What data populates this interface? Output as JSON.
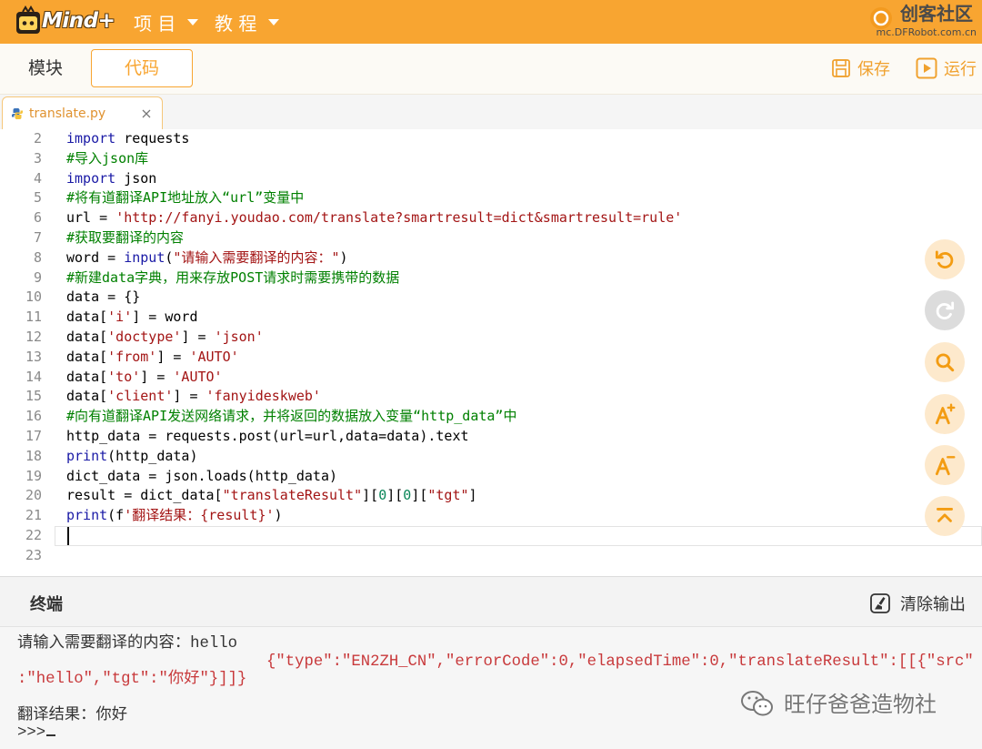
{
  "app": {
    "logo_text": "Mind+",
    "menu": [
      {
        "label": "项 目",
        "icon": "chevron-down-icon"
      },
      {
        "label": "教 程",
        "icon": "chevron-down-icon"
      }
    ],
    "brand": {
      "title": "创客社区",
      "url": "mc.DFRobot.com.cn",
      "icon": "dfrobot-logo-icon"
    }
  },
  "toolbar": {
    "tabs": [
      {
        "label": "模块",
        "active": false
      },
      {
        "label": "代码",
        "active": true
      }
    ],
    "save_label": "保存",
    "save_icon": "save-icon",
    "run_label": "运行",
    "run_icon": "run-icon"
  },
  "file_tab": {
    "name": "translate.py",
    "icon": "python-file-icon",
    "close_icon": "close-icon"
  },
  "editor": {
    "current_line": 22,
    "lines": [
      {
        "n": 2,
        "tokens": [
          {
            "kw": "import"
          },
          {
            "txt": " requests"
          }
        ]
      },
      {
        "n": 3,
        "tokens": [
          {
            "cm": "#导入json库"
          }
        ]
      },
      {
        "n": 4,
        "tokens": [
          {
            "kw": "import"
          },
          {
            "txt": " json"
          }
        ]
      },
      {
        "n": 5,
        "tokens": [
          {
            "cm": "#将有道翻译API地址放入“url”变量中"
          }
        ]
      },
      {
        "n": 6,
        "tokens": [
          {
            "txt": "url = "
          },
          {
            "str": "'http://fanyi.youdao.com/translate?smartresult=dict&smartresult=rule'"
          }
        ]
      },
      {
        "n": 7,
        "tokens": [
          {
            "cm": "#获取要翻译的内容"
          }
        ]
      },
      {
        "n": 8,
        "tokens": [
          {
            "txt": "word = "
          },
          {
            "kw": "input"
          },
          {
            "txt": "("
          },
          {
            "str": "\"请输入需要翻译的内容：\""
          },
          {
            "txt": ")"
          }
        ]
      },
      {
        "n": 9,
        "tokens": [
          {
            "cm": "#新建data字典，用来存放POST请求时需要携带的数据"
          }
        ]
      },
      {
        "n": 10,
        "tokens": [
          {
            "txt": "data = {}"
          }
        ]
      },
      {
        "n": 11,
        "tokens": [
          {
            "txt": "data["
          },
          {
            "str": "'i'"
          },
          {
            "txt": "] = word"
          }
        ]
      },
      {
        "n": 12,
        "tokens": [
          {
            "txt": "data["
          },
          {
            "str": "'doctype'"
          },
          {
            "txt": "] = "
          },
          {
            "str": "'json'"
          }
        ]
      },
      {
        "n": 13,
        "tokens": [
          {
            "txt": "data["
          },
          {
            "str": "'from'"
          },
          {
            "txt": "] = "
          },
          {
            "str": "'AUTO'"
          }
        ]
      },
      {
        "n": 14,
        "tokens": [
          {
            "txt": "data["
          },
          {
            "str": "'to'"
          },
          {
            "txt": "] = "
          },
          {
            "str": "'AUTO'"
          }
        ]
      },
      {
        "n": 15,
        "tokens": [
          {
            "txt": "data["
          },
          {
            "str": "'client'"
          },
          {
            "txt": "] = "
          },
          {
            "str": "'fanyideskweb'"
          }
        ]
      },
      {
        "n": 16,
        "tokens": [
          {
            "cm": "#向有道翻译API发送网络请求，并将返回的数据放入变量“http_data”中"
          }
        ]
      },
      {
        "n": 17,
        "tokens": [
          {
            "txt": "http_data = requests.post(url=url,data=data).text"
          }
        ]
      },
      {
        "n": 18,
        "tokens": [
          {
            "kw": "print"
          },
          {
            "txt": "(http_data)"
          }
        ]
      },
      {
        "n": 19,
        "tokens": [
          {
            "txt": "dict_data = json.loads(http_data)"
          }
        ]
      },
      {
        "n": 20,
        "tokens": [
          {
            "txt": "result = dict_data["
          },
          {
            "str": "\"translateResult\""
          },
          {
            "txt": "]["
          },
          {
            "num": "0"
          },
          {
            "txt": "]["
          },
          {
            "num": "0"
          },
          {
            "txt": "]["
          },
          {
            "str": "\"tgt\""
          },
          {
            "txt": "]"
          }
        ]
      },
      {
        "n": 21,
        "tokens": [
          {
            "kw": "print"
          },
          {
            "txt": "(f"
          },
          {
            "str": "'翻译结果：{result}'"
          },
          {
            "txt": ")"
          }
        ]
      },
      {
        "n": 22,
        "tokens": []
      },
      {
        "n": 23,
        "tokens": []
      }
    ]
  },
  "side_tools": [
    {
      "icon": "undo-icon",
      "enabled": true
    },
    {
      "icon": "redo-icon",
      "enabled": false
    },
    {
      "icon": "search-icon",
      "enabled": true
    },
    {
      "icon": "font-increase-icon",
      "enabled": true
    },
    {
      "icon": "font-decrease-icon",
      "enabled": true
    },
    {
      "icon": "scroll-top-icon",
      "enabled": true
    }
  ],
  "terminal": {
    "title": "终端",
    "clear_label": "清除输出",
    "clear_icon": "clear-output-icon",
    "input_line": "请输入需要翻译的内容：hello",
    "response_lines": [
      "{\"type\":\"EN2ZH_CN\",\"errorCode\":0,\"elapsedTime\":0,\"translateResult\":[[{\"src\"",
      ":\"hello\",\"tgt\":\"你好\"}]]}"
    ],
    "result_line": "翻译结果：你好",
    "prompt": ">>>"
  },
  "watermark": {
    "text": "旺仔爸爸造物社",
    "icon": "wechat-icon"
  },
  "colors": {
    "accent": "#f8a531",
    "keyword": "#1a1aa6",
    "comment": "#008000",
    "string": "#a31515",
    "number": "#098658",
    "terminal_output": "#c8393b"
  }
}
